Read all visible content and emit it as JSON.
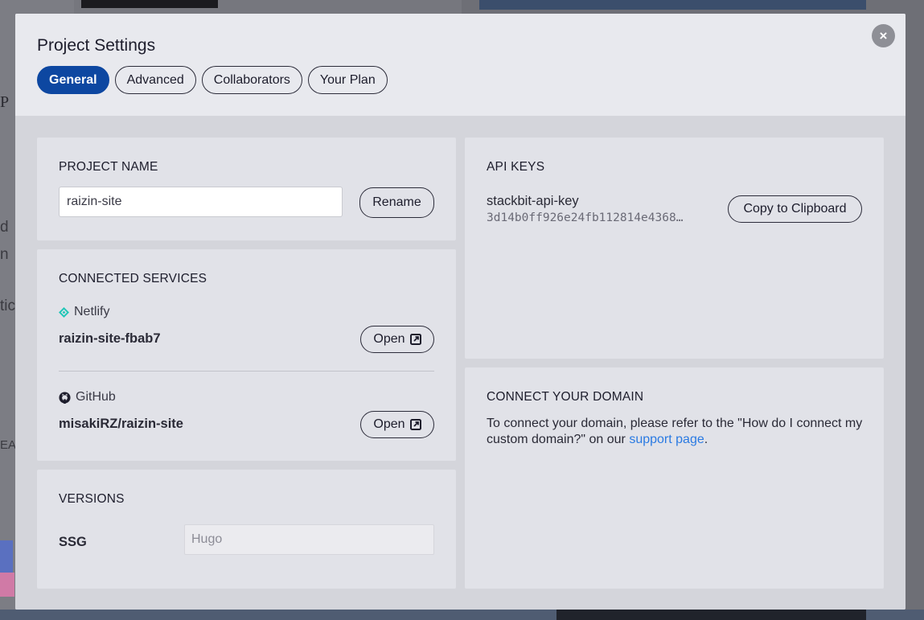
{
  "background": {
    "fragments": [
      "P",
      "d",
      "n",
      "tic",
      "EA"
    ]
  },
  "modal": {
    "title": "Project Settings",
    "close_glyph": "×",
    "tabs": [
      {
        "label": "General",
        "active": true
      },
      {
        "label": "Advanced",
        "active": false
      },
      {
        "label": "Collaborators",
        "active": false
      },
      {
        "label": "Your Plan",
        "active": false
      }
    ]
  },
  "project_name": {
    "heading": "PROJECT NAME",
    "value": "raizin-site",
    "rename_label": "Rename"
  },
  "connected_services": {
    "heading": "CONNECTED SERVICES",
    "services": [
      {
        "provider": "Netlify",
        "icon": "netlify-icon",
        "name": "raizin-site-fbab7",
        "open_label": "Open"
      },
      {
        "provider": "GitHub",
        "icon": "github-icon",
        "name": "misakiRZ/raizin-site",
        "open_label": "Open"
      }
    ]
  },
  "versions": {
    "heading": "VERSIONS",
    "ssg_label": "SSG",
    "ssg_value": "Hugo"
  },
  "api_keys": {
    "heading": "API KEYS",
    "key_name": "stackbit-api-key",
    "key_value": "3d14b0ff926e24fb112814e4368…",
    "copy_label": "Copy to Clipboard"
  },
  "domain": {
    "heading": "CONNECT YOUR DOMAIN",
    "text_before": "To connect your domain, please refer to the \"How do I connect my custom domain?\" on our ",
    "link_text": "support page",
    "text_after": "."
  },
  "colors": {
    "accent": "#0d47a1",
    "link": "#2a7ae2",
    "netlify": "#20c6b7"
  }
}
